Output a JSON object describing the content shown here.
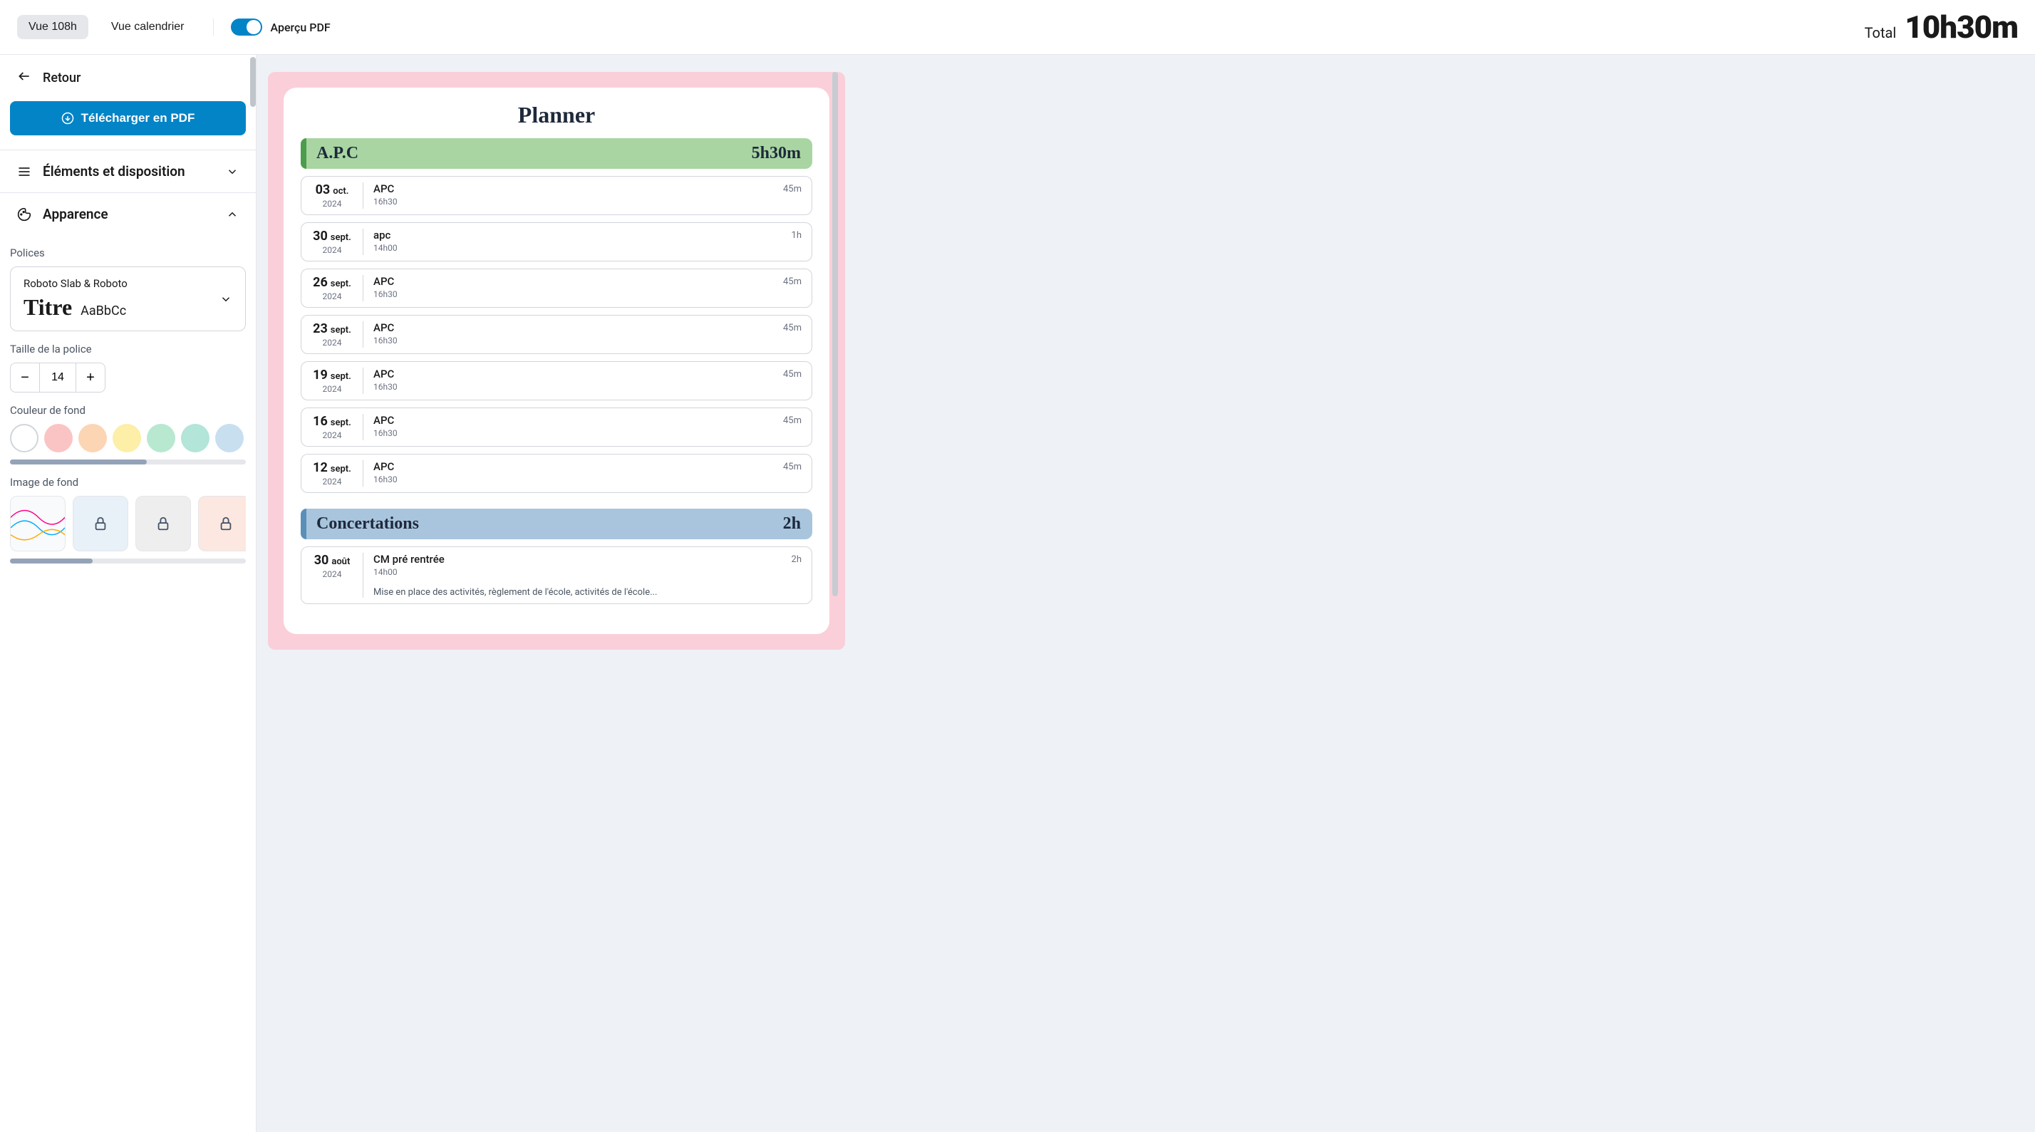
{
  "topbar": {
    "view108h": "Vue 108h",
    "viewCalendar": "Vue calendrier",
    "pdfPreview": "Aperçu PDF",
    "totalLabel": "Total",
    "totalValue": "10h30m"
  },
  "sidebar": {
    "back": "Retour",
    "download": "Télécharger en PDF",
    "elementsSection": "Éléments et disposition",
    "appearanceSection": "Apparence",
    "fontsLabel": "Polices",
    "fontName": "Roboto Slab & Roboto",
    "fontPreviewTitle": "Titre",
    "fontPreviewBody": "AaBbCc",
    "fontSizeLabel": "Taille de la police",
    "fontSizeValue": "14",
    "bgColorLabel": "Couleur de fond",
    "bgColors": [
      "#ffffff",
      "#fbc4c4",
      "#fcd5b4",
      "#fdeea8",
      "#b8e8d0",
      "#b3e5d8",
      "#c8dff0"
    ],
    "bgImageLabel": "Image de fond"
  },
  "preview": {
    "title": "Planner",
    "groups": [
      {
        "name": "A.P.C",
        "duration": "5h30m",
        "class": "group-apc",
        "entries": [
          {
            "day": "03",
            "month": "oct.",
            "year": "2024",
            "title": "APC",
            "time": "16h30",
            "duration": "45m"
          },
          {
            "day": "30",
            "month": "sept.",
            "year": "2024",
            "title": "apc",
            "time": "14h00",
            "duration": "1h"
          },
          {
            "day": "26",
            "month": "sept.",
            "year": "2024",
            "title": "APC",
            "time": "16h30",
            "duration": "45m"
          },
          {
            "day": "23",
            "month": "sept.",
            "year": "2024",
            "title": "APC",
            "time": "16h30",
            "duration": "45m"
          },
          {
            "day": "19",
            "month": "sept.",
            "year": "2024",
            "title": "APC",
            "time": "16h30",
            "duration": "45m"
          },
          {
            "day": "16",
            "month": "sept.",
            "year": "2024",
            "title": "APC",
            "time": "16h30",
            "duration": "45m"
          },
          {
            "day": "12",
            "month": "sept.",
            "year": "2024",
            "title": "APC",
            "time": "16h30",
            "duration": "45m"
          }
        ]
      },
      {
        "name": "Concertations",
        "duration": "2h",
        "class": "group-concert",
        "entries": [
          {
            "day": "30",
            "month": "août",
            "year": "2024",
            "title": "CM pré rentrée",
            "time": "14h00",
            "duration": "2h",
            "desc": "Mise en place des activités, règlement de l'école, activités de l'école..."
          }
        ]
      }
    ]
  }
}
